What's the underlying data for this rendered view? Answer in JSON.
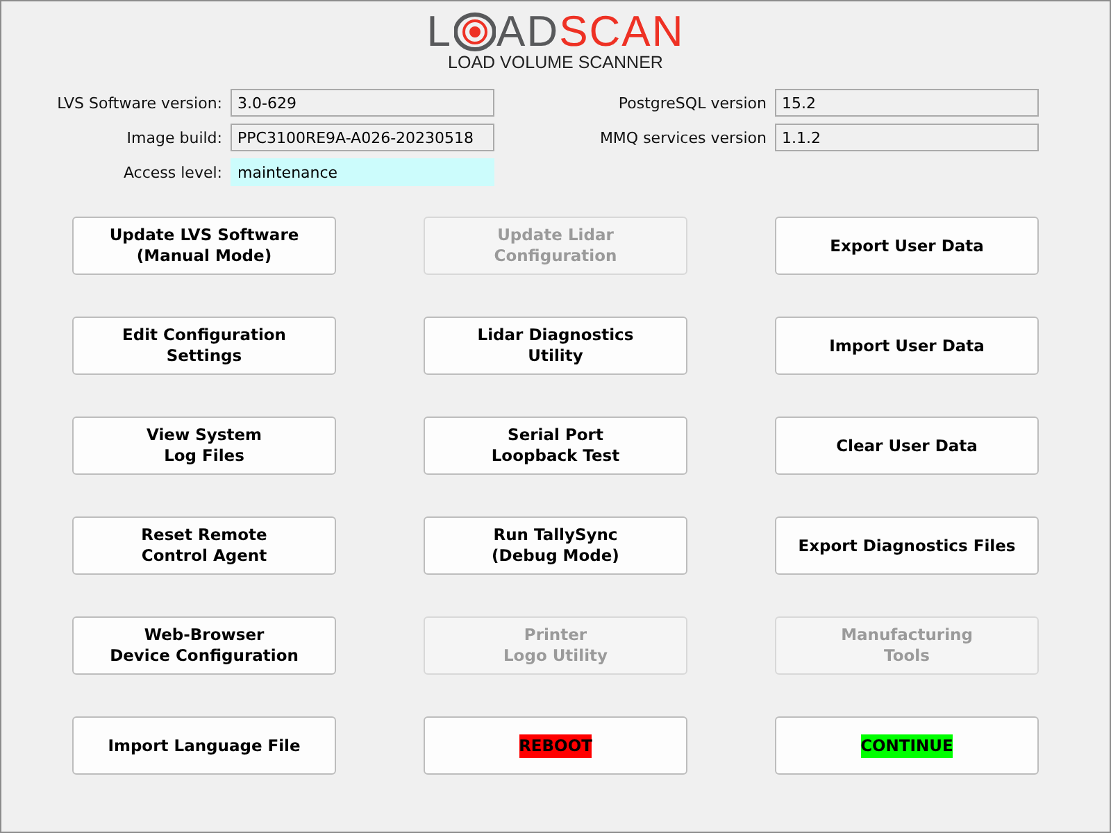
{
  "logo": {
    "lead": "L",
    "middle": "AD",
    "accent": "SCAN",
    "subtitle": "LOAD VOLUME SCANNER"
  },
  "info_left": [
    {
      "label": "LVS Software version:",
      "value": "3.0-629",
      "highlighted": false
    },
    {
      "label": "Image build:",
      "value": "PPC3100RE9A-A026-20230518",
      "highlighted": false
    },
    {
      "label": "Access level:",
      "value": "maintenance",
      "highlighted": true
    }
  ],
  "info_right": [
    {
      "label": "PostgreSQL version",
      "value": "15.2",
      "highlighted": false
    },
    {
      "label": "MMQ services version",
      "value": "1.1.2",
      "highlighted": false
    }
  ],
  "buttons": [
    {
      "lines": [
        "Update LVS Software",
        "(Manual Mode)"
      ],
      "disabled": false
    },
    {
      "lines": [
        "Update Lidar",
        "Configuration"
      ],
      "disabled": true
    },
    {
      "lines": [
        "Export User Data"
      ],
      "disabled": false
    },
    {
      "lines": [
        "Edit Configuration",
        "Settings"
      ],
      "disabled": false
    },
    {
      "lines": [
        "Lidar Diagnostics",
        "Utility"
      ],
      "disabled": false
    },
    {
      "lines": [
        "Import User Data"
      ],
      "disabled": false
    },
    {
      "lines": [
        "View System",
        "Log Files"
      ],
      "disabled": false
    },
    {
      "lines": [
        "Serial Port",
        "Loopback Test"
      ],
      "disabled": false
    },
    {
      "lines": [
        "Clear User Data"
      ],
      "disabled": false
    },
    {
      "lines": [
        "Reset Remote",
        "Control Agent"
      ],
      "disabled": false
    },
    {
      "lines": [
        "Run TallySync",
        "(Debug Mode)"
      ],
      "disabled": false
    },
    {
      "lines": [
        "Export Diagnostics Files"
      ],
      "disabled": false
    },
    {
      "lines": [
        "Web-Browser",
        "Device Configuration"
      ],
      "disabled": false
    },
    {
      "lines": [
        "Printer",
        "Logo Utility"
      ],
      "disabled": true
    },
    {
      "lines": [
        "Manufacturing",
        "Tools"
      ],
      "disabled": true
    },
    {
      "lines": [
        "Import Language File"
      ],
      "disabled": false
    },
    {
      "lines": [
        "REBOOT"
      ],
      "disabled": false,
      "color": "#ff0000"
    },
    {
      "lines": [
        "CONTINUE"
      ],
      "disabled": false,
      "color": "#00ff00"
    }
  ]
}
